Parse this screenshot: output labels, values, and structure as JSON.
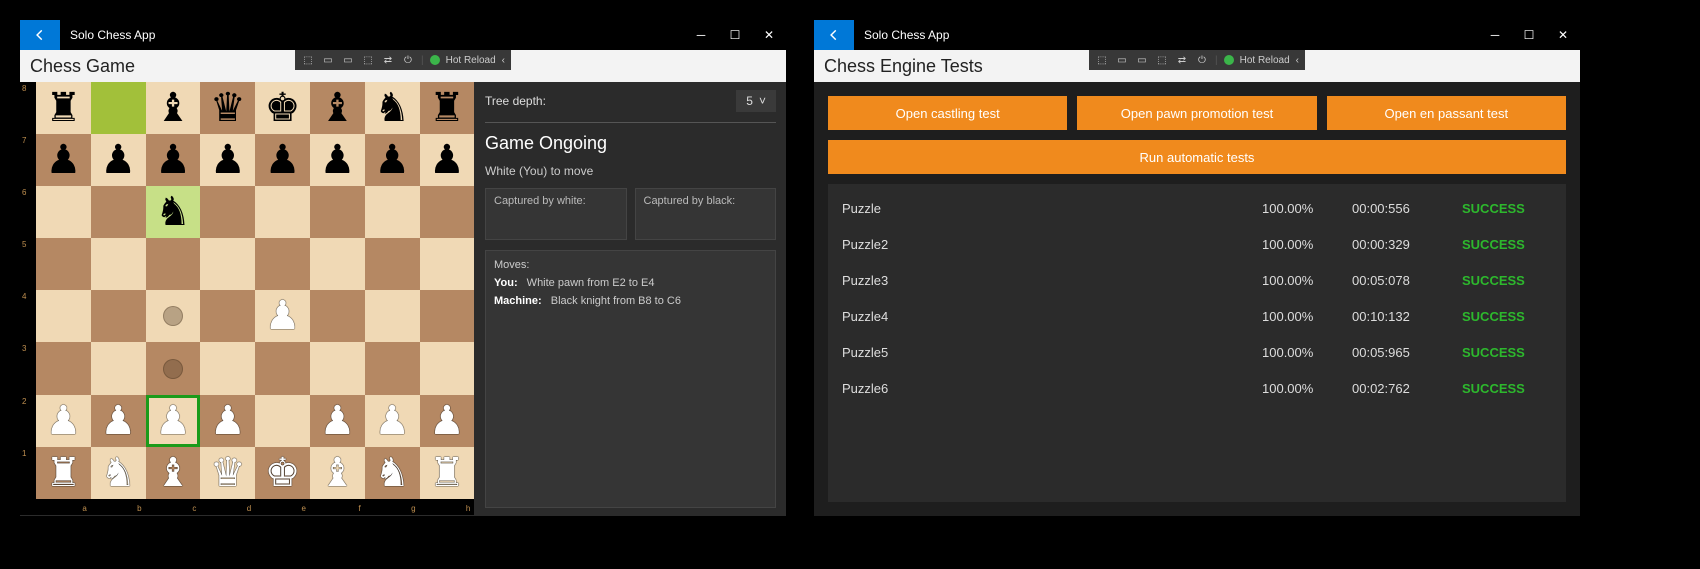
{
  "app_title": "Solo Chess App",
  "hot_reload_label": "Hot Reload",
  "left_window": {
    "page_title": "Chess Game",
    "tree_depth_label": "Tree depth:",
    "tree_depth_value": "5",
    "status_title": "Game Ongoing",
    "status_sub": "White (You) to move",
    "captured_white_label": "Captured by white:",
    "captured_black_label": "Captured by black:",
    "moves_label": "Moves:",
    "moves": [
      {
        "who": "You:",
        "text": "White pawn from E2 to E4"
      },
      {
        "who": "Machine:",
        "text": "Black knight from B8 to C6"
      }
    ],
    "board": {
      "ranks": [
        "8",
        "7",
        "6",
        "5",
        "4",
        "3",
        "2",
        "1"
      ],
      "files": [
        "a",
        "b",
        "c",
        "d",
        "e",
        "f",
        "g",
        "h"
      ],
      "rows": [
        [
          {
            "p": "r",
            "c": "b"
          },
          {
            "p": "",
            "hl": "green"
          },
          {
            "p": "b",
            "c": "b"
          },
          {
            "p": "q",
            "c": "b"
          },
          {
            "p": "k",
            "c": "b"
          },
          {
            "p": "b",
            "c": "b"
          },
          {
            "p": "n",
            "c": "b"
          },
          {
            "p": "r",
            "c": "b"
          }
        ],
        [
          {
            "p": "p",
            "c": "b"
          },
          {
            "p": "p",
            "c": "b"
          },
          {
            "p": "p",
            "c": "b"
          },
          {
            "p": "p",
            "c": "b"
          },
          {
            "p": "p",
            "c": "b"
          },
          {
            "p": "p",
            "c": "b"
          },
          {
            "p": "p",
            "c": "b"
          },
          {
            "p": "p",
            "c": "b"
          }
        ],
        [
          {
            "p": ""
          },
          {
            "p": ""
          },
          {
            "p": "n",
            "c": "b",
            "hl": "greenlt"
          },
          {
            "p": ""
          },
          {
            "p": ""
          },
          {
            "p": ""
          },
          {
            "p": ""
          },
          {
            "p": ""
          }
        ],
        [
          {
            "p": ""
          },
          {
            "p": ""
          },
          {
            "p": ""
          },
          {
            "p": ""
          },
          {
            "p": ""
          },
          {
            "p": ""
          },
          {
            "p": ""
          },
          {
            "p": ""
          }
        ],
        [
          {
            "p": ""
          },
          {
            "p": ""
          },
          {
            "p": "",
            "dot": true
          },
          {
            "p": ""
          },
          {
            "p": "p",
            "c": "w"
          },
          {
            "p": ""
          },
          {
            "p": ""
          },
          {
            "p": ""
          }
        ],
        [
          {
            "p": ""
          },
          {
            "p": ""
          },
          {
            "p": "",
            "dot": true
          },
          {
            "p": ""
          },
          {
            "p": ""
          },
          {
            "p": ""
          },
          {
            "p": ""
          },
          {
            "p": ""
          }
        ],
        [
          {
            "p": "p",
            "c": "w"
          },
          {
            "p": "p",
            "c": "w"
          },
          {
            "p": "p",
            "c": "w",
            "sel": true
          },
          {
            "p": "p",
            "c": "w"
          },
          {
            "p": ""
          },
          {
            "p": "p",
            "c": "w"
          },
          {
            "p": "p",
            "c": "w"
          },
          {
            "p": "p",
            "c": "w"
          }
        ],
        [
          {
            "p": "r",
            "c": "w"
          },
          {
            "p": "n",
            "c": "w"
          },
          {
            "p": "b",
            "c": "w"
          },
          {
            "p": "q",
            "c": "w"
          },
          {
            "p": "k",
            "c": "w"
          },
          {
            "p": "b",
            "c": "w"
          },
          {
            "p": "n",
            "c": "w"
          },
          {
            "p": "r",
            "c": "w"
          }
        ]
      ]
    }
  },
  "right_window": {
    "page_title": "Chess Engine Tests",
    "buttons": {
      "castling": "Open castling test",
      "promotion": "Open pawn promotion test",
      "enpassant": "Open en passant test",
      "run": "Run automatic tests"
    },
    "results": [
      {
        "name": "Puzzle",
        "pct": "100.00%",
        "time": "00:00:556",
        "status": "SUCCESS"
      },
      {
        "name": "Puzzle2",
        "pct": "100.00%",
        "time": "00:00:329",
        "status": "SUCCESS"
      },
      {
        "name": "Puzzle3",
        "pct": "100.00%",
        "time": "00:05:078",
        "status": "SUCCESS"
      },
      {
        "name": "Puzzle4",
        "pct": "100.00%",
        "time": "00:10:132",
        "status": "SUCCESS"
      },
      {
        "name": "Puzzle5",
        "pct": "100.00%",
        "time": "00:05:965",
        "status": "SUCCESS"
      },
      {
        "name": "Puzzle6",
        "pct": "100.00%",
        "time": "00:02:762",
        "status": "SUCCESS"
      }
    ]
  }
}
